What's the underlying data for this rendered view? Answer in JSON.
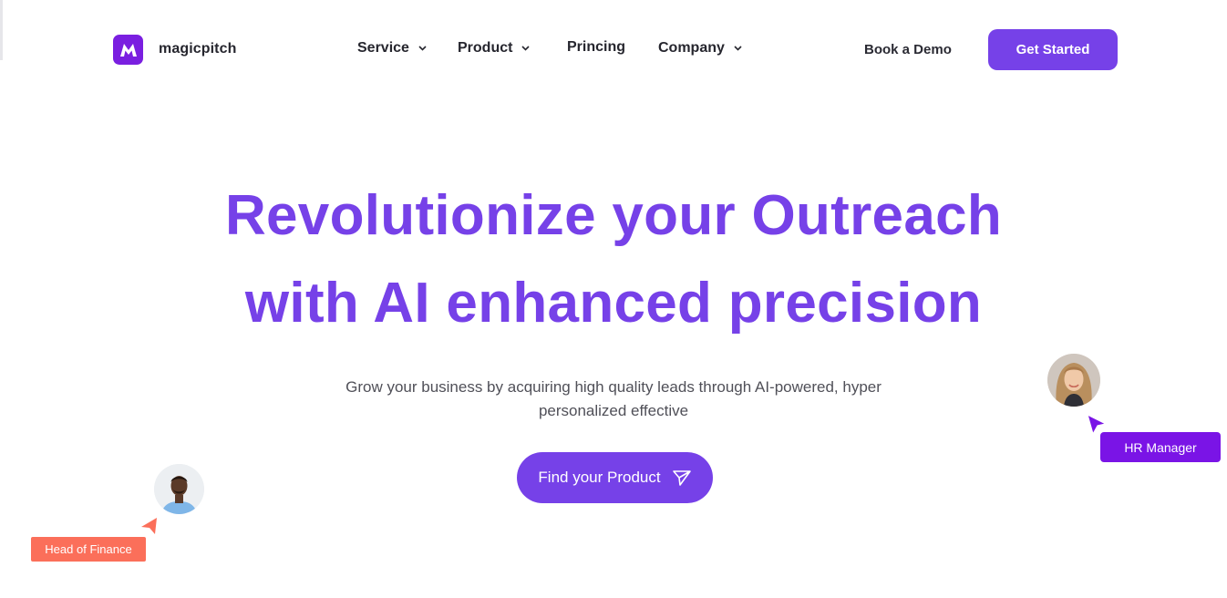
{
  "header": {
    "brand_name": "magicpitch",
    "nav": {
      "service": "Service",
      "product": "Product",
      "pricing": "Princing",
      "company": "Company"
    },
    "book_demo": "Book a Demo",
    "get_started": "Get Started"
  },
  "hero": {
    "headline_line1": "Revolutionize your Outreach",
    "headline_line2": "with AI enhanced precision",
    "subtext_line1": "Grow your business by acquiring high quality leads through AI-powered, hyper",
    "subtext_line2": "personalized effective",
    "cta_label": "Find your Product"
  },
  "personas": {
    "left_tag": "Head of Finance",
    "right_tag": "HR Manager"
  },
  "colors": {
    "accent": "#7641e8",
    "logo": "#7a1fe0",
    "finance_tag": "#fb6f5a",
    "hr_tag": "#7a14e6"
  },
  "icons": {
    "logo": "magicpitch-logo-icon",
    "nav_dropdown": "chevron-down-icon",
    "cta": "send-icon",
    "cursor": "cursor-pointer-icon"
  }
}
